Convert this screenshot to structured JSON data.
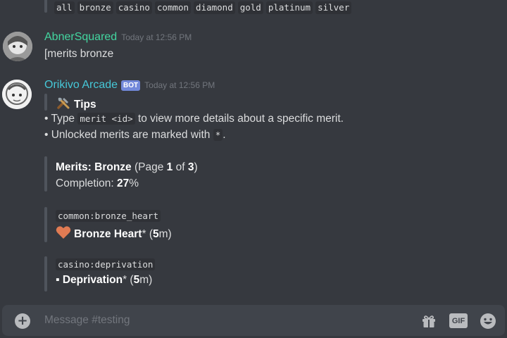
{
  "top_tags": [
    "all",
    "bronze",
    "casino",
    "common",
    "diamond",
    "gold",
    "platinum",
    "silver"
  ],
  "messages": [
    {
      "username": "AbnerSquared",
      "timestamp": "Today at 12:56 PM",
      "content": "[merits bronze",
      "name_color": "#43d6a0"
    },
    {
      "username": "Orikivo Arcade",
      "bot_tag": "BOT",
      "timestamp": "Today at 12:56 PM",
      "name_color": "#46c8d8",
      "tips": {
        "title": "Tips",
        "line1_prefix": "• Type ",
        "line1_code": "merit <id>",
        "line1_suffix": " to view more details about a specific merit.",
        "line2_prefix": "• Unlocked merits are marked with ",
        "line2_code": "*",
        "line2_suffix": "."
      },
      "summary": {
        "title": "Merits: Bronze",
        "page_prefix": " (Page ",
        "page": "1",
        "page_mid": " of ",
        "total_pages": "3",
        "page_suffix": ")",
        "completion_label": "Completion: ",
        "completion_value": "27",
        "completion_suffix": "%"
      },
      "merits": [
        {
          "id": "common:bronze_heart",
          "icon": "heart-icon",
          "name": "Bronze Heart",
          "unlocked_mark": "*",
          "value_prefix": " (",
          "value": "5",
          "unit": "m",
          "value_suffix": ")"
        },
        {
          "id": "casino:deprivation",
          "icon": "bullet",
          "bullet": "▪ ",
          "name": "Deprivation",
          "unlocked_mark": "*",
          "value_prefix": " (",
          "value": "5",
          "unit": "m",
          "value_suffix": ")"
        }
      ]
    }
  ],
  "composer": {
    "placeholder": "Message #testing",
    "gif_label": "GIF"
  },
  "colors": {
    "background": "#36393f",
    "composer": "#40444b",
    "bot_tag": "#7289da",
    "heart": "#e07b53"
  }
}
